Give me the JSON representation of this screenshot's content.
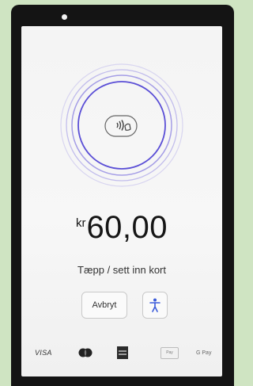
{
  "payment": {
    "currency": "kr",
    "amount": "60,00",
    "instruction": "Tæpp / sett inn kort"
  },
  "buttons": {
    "cancel_label": "Avbryt",
    "accessibility_icon": "accessibility-icon"
  },
  "logos": {
    "visa": "VISA",
    "mastercard_icon": "mastercard-logo",
    "amex_icon": "amex-logo",
    "apple_pay": "Pay",
    "google_pay": "G Pay"
  },
  "colors": {
    "ring": "#a59ee6",
    "ring_strong": "#5b4fd6",
    "accessibility_accent": "#3b5bd9",
    "background": "#cfe4c2"
  }
}
